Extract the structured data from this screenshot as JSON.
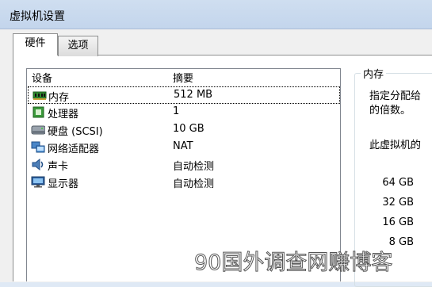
{
  "window": {
    "title": "虚拟机设置"
  },
  "tabs": [
    {
      "label": "硬件"
    },
    {
      "label": "选项"
    }
  ],
  "hardware_list": {
    "columns": {
      "device": "设备",
      "summary": "摘要"
    },
    "rows": [
      {
        "icon": "memory-icon",
        "name": "内存",
        "summary": "512 MB"
      },
      {
        "icon": "processor-icon",
        "name": "处理器",
        "summary": "1"
      },
      {
        "icon": "hard-disk-icon",
        "name": "硬盘 (SCSI)",
        "summary": "10 GB"
      },
      {
        "icon": "network-adapter-icon",
        "name": "网络适配器",
        "summary": "NAT"
      },
      {
        "icon": "sound-card-icon",
        "name": "声卡",
        "summary": "自动检测"
      },
      {
        "icon": "display-icon",
        "name": "显示器",
        "summary": "自动检测"
      }
    ]
  },
  "memory_panel": {
    "title": "内存",
    "desc_line1": "指定分配给",
    "desc_line2": "的倍数。",
    "desc_line3": "此虚拟机的",
    "scale_labels": [
      "64 GB",
      "32 GB",
      "16 GB",
      "8 GB"
    ]
  },
  "watermark": "90国外调查网赚博客",
  "colors": {
    "title_bar": "#c9daef",
    "client_bg": "#f0f0f0",
    "list_border": "#828790"
  }
}
